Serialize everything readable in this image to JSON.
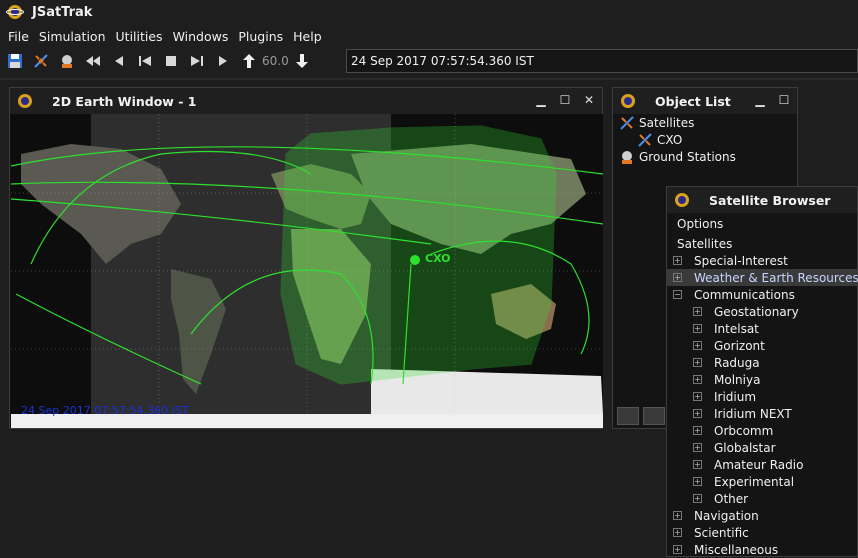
{
  "app": {
    "title": "JSatTrak"
  },
  "menu": [
    "File",
    "Simulation",
    "Utilities",
    "Windows",
    "Plugins",
    "Help"
  ],
  "toolbar": {
    "step_value": "60.0",
    "time": "24 Sep 2017 07:57:54.360 IST"
  },
  "earth_window": {
    "title": "2D Earth Window - 1",
    "map_time": "24 Sep 2017 07:57:54.360 IST",
    "satellite_label": "CXO"
  },
  "object_list": {
    "title": "Object List",
    "items": [
      "Satellites",
      "CXO",
      "Ground Stations"
    ]
  },
  "sat_browser": {
    "title": "Satellite Browser",
    "options_label": "Options",
    "root": "Satellites",
    "rows": [
      {
        "label": "Special-Interest",
        "level": 1
      },
      {
        "label": "Weather & Earth Resources",
        "level": 1,
        "selected": true
      },
      {
        "label": "Communications",
        "level": 1,
        "expanded": true
      },
      {
        "label": "Geostationary",
        "level": 2
      },
      {
        "label": "Intelsat",
        "level": 2
      },
      {
        "label": "Gorizont",
        "level": 2
      },
      {
        "label": "Raduga",
        "level": 2
      },
      {
        "label": "Molniya",
        "level": 2
      },
      {
        "label": "Iridium",
        "level": 2
      },
      {
        "label": "Iridium NEXT",
        "level": 2
      },
      {
        "label": "Orbcomm",
        "level": 2
      },
      {
        "label": "Globalstar",
        "level": 2
      },
      {
        "label": "Amateur Radio",
        "level": 2
      },
      {
        "label": "Experimental",
        "level": 2
      },
      {
        "label": "Other",
        "level": 2
      },
      {
        "label": "Navigation",
        "level": 1
      },
      {
        "label": "Scientific",
        "level": 1
      },
      {
        "label": "Miscellaneous",
        "level": 1
      }
    ]
  },
  "colors": {
    "footprint": "#33dd33",
    "map_time": "#1a33d6",
    "accent": "#c8d6ff"
  }
}
